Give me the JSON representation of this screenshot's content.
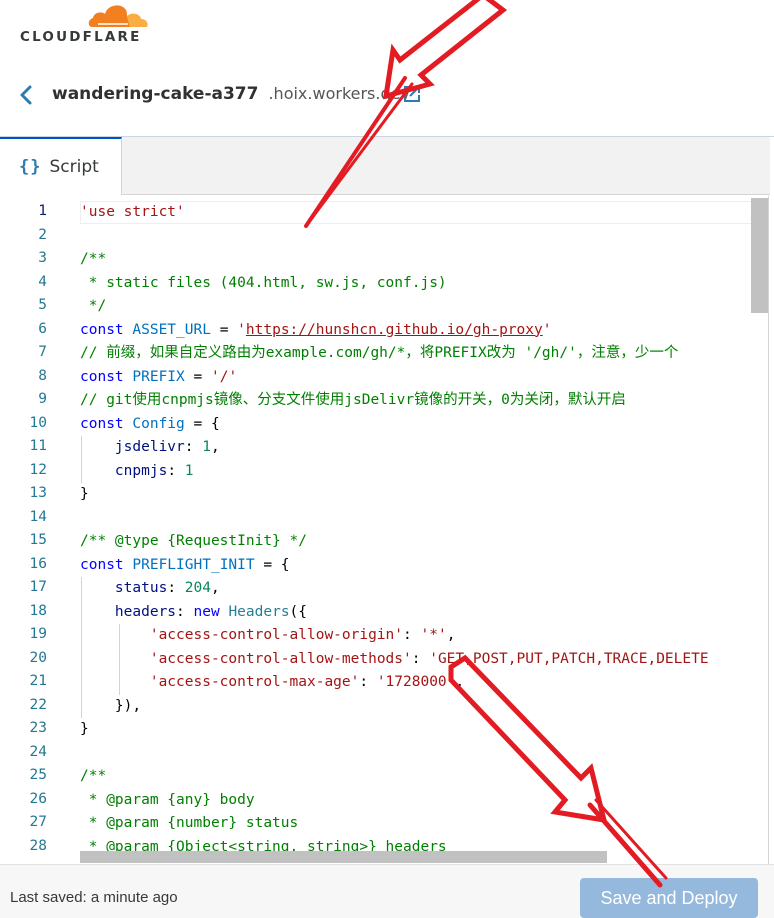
{
  "brand": {
    "name": "CLOUDFLARE",
    "cloud_color": "#f38020",
    "cloud_light_color": "#fbad41"
  },
  "header": {
    "worker_name": "wandering-cake-a377",
    "worker_domain": ".hoix.workers.dev",
    "back_icon": "chevron-left-icon",
    "external_link_icon": "external-link-icon"
  },
  "tabs": [
    {
      "icon": "{}",
      "label": "Script"
    }
  ],
  "editor": {
    "line_numbers": [
      "1",
      "2",
      "3",
      "4",
      "5",
      "6",
      "7",
      "8",
      "9",
      "10",
      "11",
      "12",
      "13",
      "14",
      "15",
      "16",
      "17",
      "18",
      "19",
      "20",
      "21",
      "22",
      "23",
      "24",
      "25",
      "26",
      "27",
      "28"
    ],
    "lines": [
      "'use strict'",
      "",
      "/**",
      " * static files (404.html, sw.js, conf.js)",
      " */",
      "const ASSET_URL = 'https://hunshcn.github.io/gh-proxy'",
      "// 前缀，如果自定义路由为example.com/gh/*，将PREFIX改为 '/gh/'，注意，少一个",
      "const PREFIX = '/'",
      "// git使用cnpmjs镜像、分支文件使用jsDelivr镜像的开关，0为关闭，默认开启",
      "const Config = {",
      "    jsdelivr: 1,",
      "    cnpmjs: 1",
      "}",
      "",
      "/** @type {RequestInit} */",
      "const PREFLIGHT_INIT = {",
      "    status: 204,",
      "    headers: new Headers({",
      "        'access-control-allow-origin': '*',",
      "        'access-control-allow-methods': 'GET,POST,PUT,PATCH,TRACE,DELETE",
      "        'access-control-max-age': '1728000',",
      "    }),",
      "}",
      "",
      "/**",
      " * @param {any} body",
      " * @param {number} status",
      " * @param {Object<string, string>} headers"
    ]
  },
  "footer": {
    "last_saved": "Last saved: a minute ago",
    "deploy_button": "Save and Deploy"
  },
  "colors": {
    "accent": "#0051c3",
    "deploy_button_bg": "#94b9dc",
    "annotation_arrow": "#e31b23"
  }
}
